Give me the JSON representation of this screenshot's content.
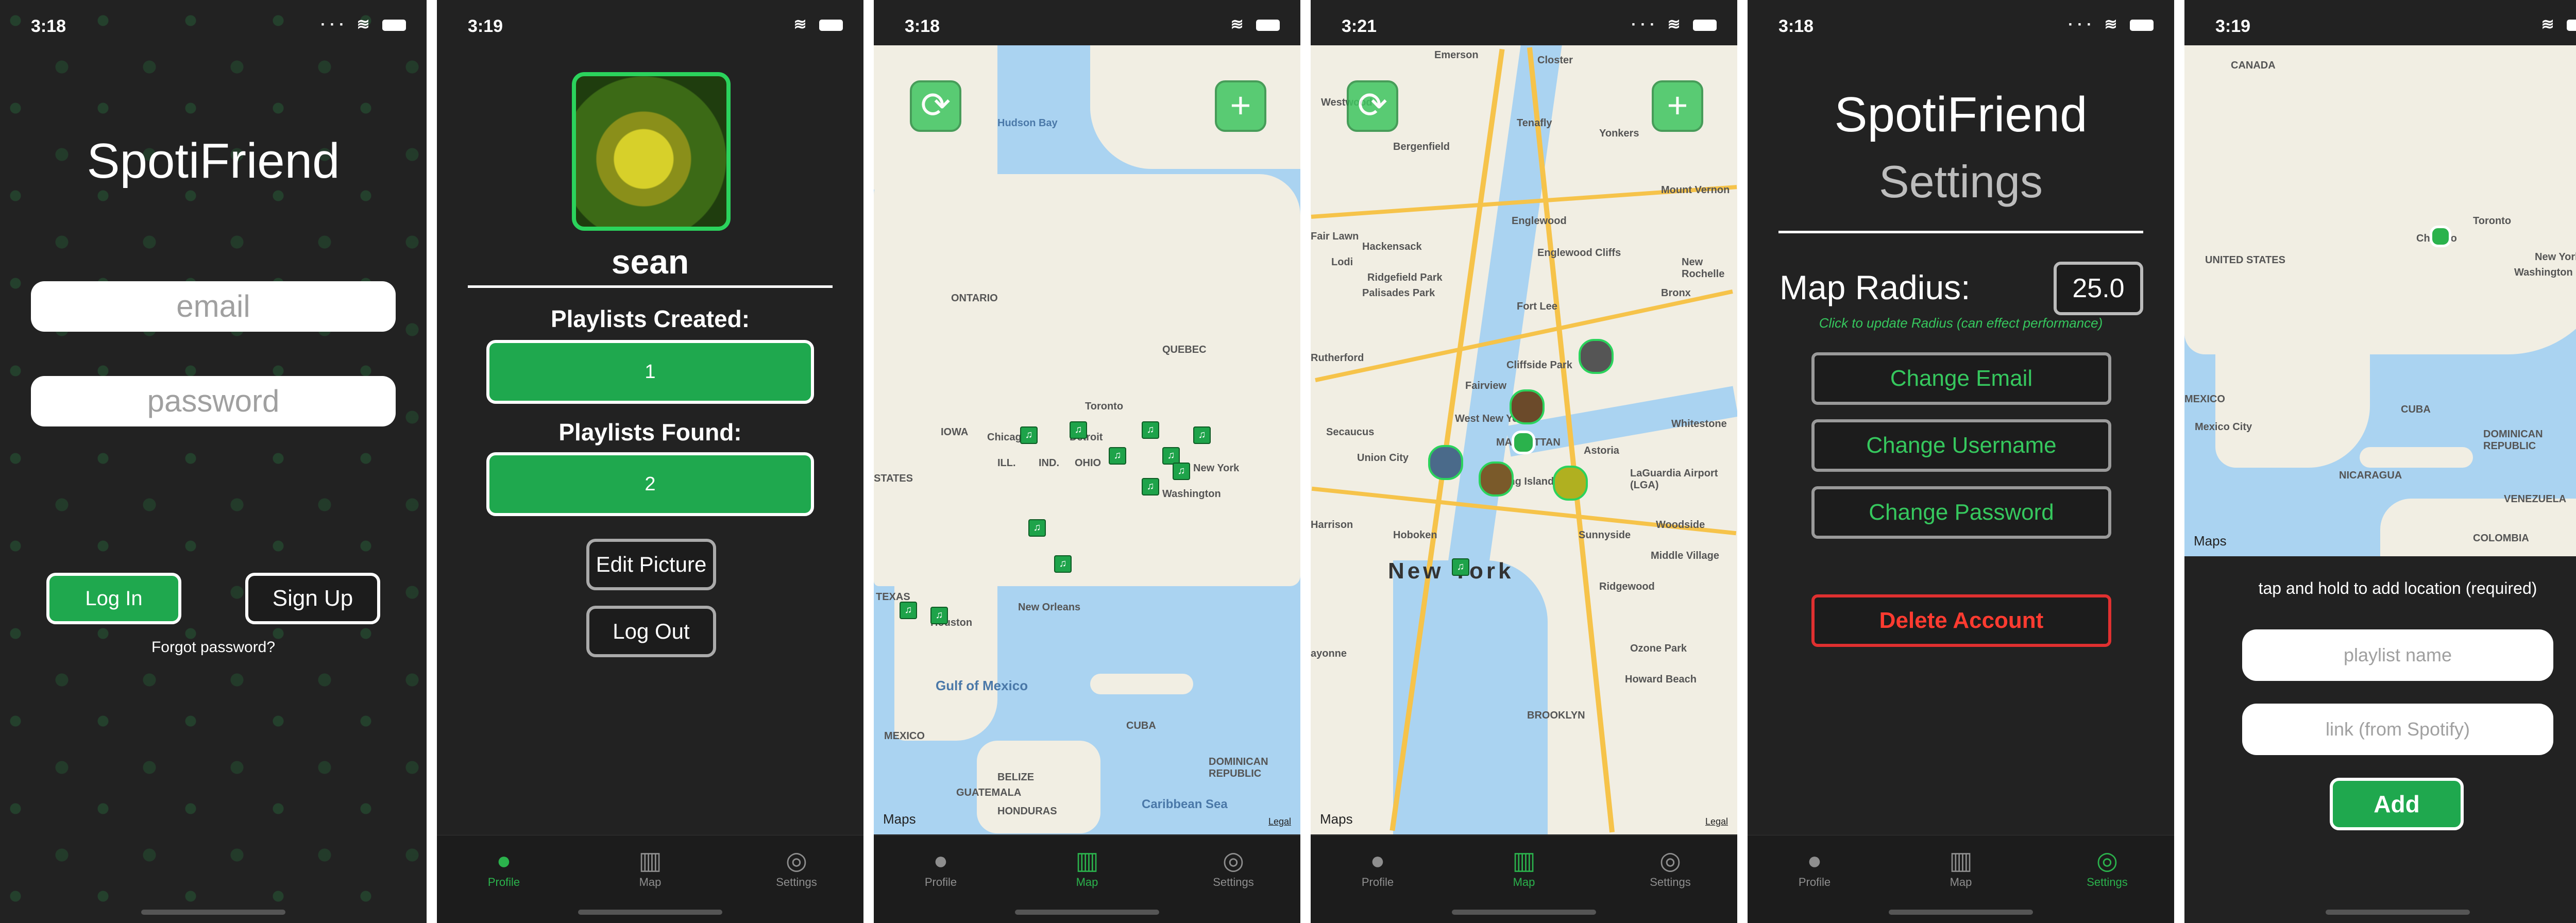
{
  "status": {
    "s1_time": "3:18",
    "s2_time": "3:19",
    "s3_time": "3:18",
    "s4_time": "3:21",
    "s5_time": "3:18",
    "s6_time": "3:19"
  },
  "login": {
    "app_title": "SpotiFriend",
    "email_placeholder": "email",
    "password_placeholder": "password",
    "login_label": "Log In",
    "signup_label": "Sign Up",
    "forgot_label": "Forgot password?"
  },
  "profile": {
    "username": "sean",
    "created_label": "Playlists Created:",
    "created_count": "1",
    "found_label": "Playlists Found:",
    "found_count": "2",
    "edit_picture_label": "Edit Picture",
    "logout_label": "Log Out"
  },
  "tabs": {
    "profile": "Profile",
    "map": "Map",
    "settings": "Settings"
  },
  "map_ca": {
    "labels": {
      "hudson": "Hudson Bay",
      "ontario": "ONTARIO",
      "quebec": "QUEBEC",
      "iowa": "IOWA",
      "ill": "ILL.",
      "ind": "IND.",
      "ohio": "OHIO",
      "toronto": "Toronto",
      "chicago": "Chicago",
      "newyork": "New York",
      "washington": "Washington",
      "states": "STATES",
      "texas": "TEXAS",
      "gulf": "Gulf of Mexico",
      "cuba": "CUBA",
      "mexico": "MEXICO",
      "neworleans": "New Orleans",
      "houston": "Houston",
      "dominican": "DOMINICAN REPUBLIC",
      "belize": "BELIZE",
      "guatemala": "GUATEMALA",
      "honduras": "HONDURAS",
      "caribbean": "Caribbean Sea",
      "detroit": "Detroit"
    },
    "maps_brand": "Maps",
    "legal": "Legal"
  },
  "map_nyc": {
    "labels": {
      "emerson": "Emerson",
      "closter": "Closter",
      "yonkers": "Yonkers",
      "bergenfield": "Bergenfield",
      "mountvernon": "Mount Vernon",
      "englewood": "Englewood",
      "fairlawn": "Fair Lawn",
      "hackensack": "Hackensack",
      "englewoodcliffs": "Englewood Cliffs",
      "ridgefieldpark": "Ridgefield Park",
      "palisadespark": "Palisades Park",
      "bronx": "Bronx",
      "fortlee": "Fort Lee",
      "rutherford": "Rutherford",
      "cliffsidepark": "Cliffside Park",
      "fairview": "Fairview",
      "westnewyork": "West New York",
      "secaucus": "Secaucus",
      "unioncity": "Union City",
      "manhattan": "MANHATTAN",
      "astoria": "Astoria",
      "whitestone": "Whitestone",
      "laguardia": "LaGuardia Airport (LGA)",
      "longisland": "Long Island City",
      "sunnyside": "Sunnyside",
      "woodside": "Woodside",
      "hoboken": "Hoboken",
      "newyork": "New York",
      "middlevillage": "Middle Village",
      "ridgewood": "Ridgewood",
      "bayonne": "ayonne",
      "ozonepark": "Ozone Park",
      "howardbeach": "Howard Beach",
      "brooklyn": "BROOKLYN",
      "tenafly": "Tenafly",
      "lodi": "Lodi",
      "westwood": "Westwood",
      "newrochelle": "New Rochelle",
      "harrison": "Harrison"
    },
    "maps_brand": "Maps",
    "legal": "Legal"
  },
  "settings": {
    "app_title": "SpotiFriend",
    "subtitle": "Settings",
    "radius_label": "Map Radius:",
    "radius_value": "25.0",
    "radius_hint": "Click to update Radius (can effect performance)",
    "change_email": "Change Email",
    "change_username": "Change Username",
    "change_password": "Change Password",
    "delete_account": "Delete Account"
  },
  "add_screen": {
    "labels": {
      "canada": "CANADA",
      "unitedstates": "UNITED STATES",
      "mexico": "MEXICO",
      "mexicocity": "Mexico City",
      "cuba": "CUBA",
      "dominican": "DOMINICAN REPUBLIC",
      "nicaragua": "NICARAGUA",
      "colombia": "COLOMBIA",
      "venezuela": "VENEZUELA",
      "chicago": "Chicago",
      "toronto": "Toronto",
      "newyork": "New York",
      "washington": "Washington"
    },
    "maps_brand": "Maps",
    "hint": "tap and hold to add location (required)",
    "playlist_placeholder": "playlist name",
    "link_placeholder": "link (from Spotify)",
    "add_label": "Add"
  }
}
